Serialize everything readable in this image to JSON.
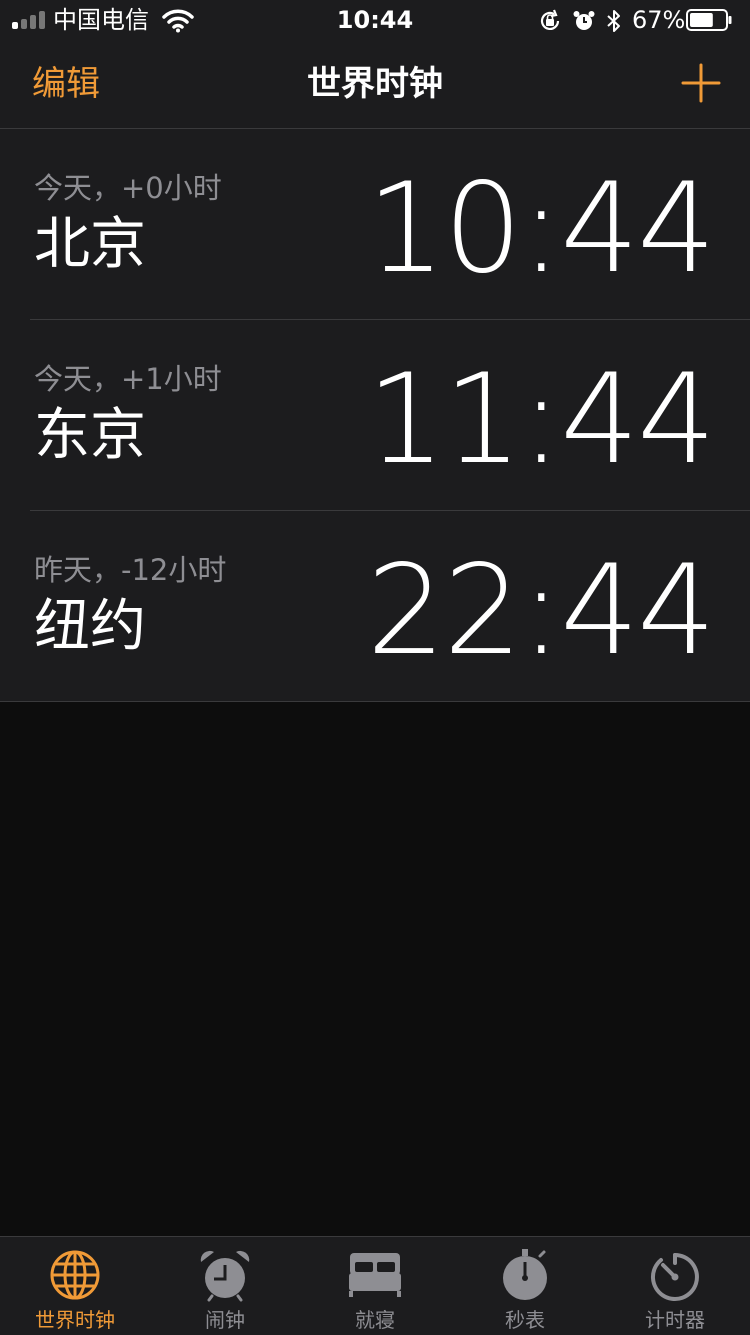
{
  "status_bar": {
    "carrier": "中国电信",
    "time": "10:44",
    "battery_percent": "67%",
    "battery_level": 0.67,
    "icons": [
      "signal-icon",
      "wifi-icon",
      "rotation-lock-icon",
      "alarm-icon",
      "bluetooth-icon",
      "battery-icon"
    ]
  },
  "nav": {
    "edit_label": "编辑",
    "title": "世界时钟",
    "add_icon": "plus-icon"
  },
  "colors": {
    "accent": "#f09a37",
    "background": "#0d0d0d",
    "cell_background": "#1c1c1e",
    "secondary_text": "#8e8e93",
    "separator": "#3a3a3c"
  },
  "clocks": [
    {
      "offset": "今天，+0小时",
      "city": "北京",
      "time": "10:44"
    },
    {
      "offset": "今天，+1小时",
      "city": "东京",
      "time": "11:44"
    },
    {
      "offset": "昨天，-12小时",
      "city": "纽约",
      "time": "22:44"
    }
  ],
  "tabs": [
    {
      "label": "世界时钟",
      "icon": "globe-icon",
      "active": true
    },
    {
      "label": "闹钟",
      "icon": "alarm-clock-icon",
      "active": false
    },
    {
      "label": "就寝",
      "icon": "bed-icon",
      "active": false
    },
    {
      "label": "秒表",
      "icon": "stopwatch-icon",
      "active": false
    },
    {
      "label": "计时器",
      "icon": "timer-icon",
      "active": false
    }
  ]
}
